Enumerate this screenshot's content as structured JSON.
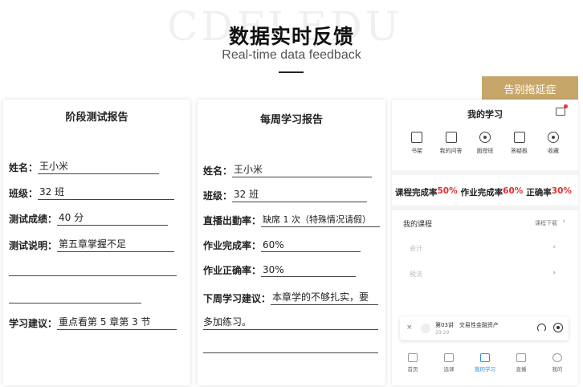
{
  "header": {
    "watermark": "CDFLEDU",
    "title": "数据实时反馈",
    "subtitle": "Real-time data feedback"
  },
  "tag_label": "告别拖延症",
  "stage_report": {
    "title": "阶段测试报告",
    "rows": [
      {
        "label": "姓名：",
        "value": "王小米"
      },
      {
        "label": "班级：",
        "value": "32 班"
      },
      {
        "label": "测试成绩：",
        "value": "40 分"
      },
      {
        "label": "测试说明：",
        "value": "第五章掌握不足"
      },
      {
        "label": "学习建议：",
        "value": "重点看第 5 章第 3 节"
      }
    ]
  },
  "weekly_report": {
    "title": "每周学习报告",
    "rows": [
      {
        "label": "姓名：",
        "value": "王小米"
      },
      {
        "label": "班级：",
        "value": "32 班"
      },
      {
        "label": "直播出勤率：",
        "value": "缺席 1 次（特殊情况请假）"
      },
      {
        "label": "作业完成率：",
        "value": "60%"
      },
      {
        "label": "作业正确率：",
        "value": "30%"
      },
      {
        "label": "下周学习建议：",
        "value": "本章学的不够扎实，要"
      }
    ],
    "continuation": "多加练习。"
  },
  "app": {
    "title": "我的学习",
    "nav": [
      {
        "label": "书架",
        "icon": "bookshelf-icon"
      },
      {
        "label": "我的问答",
        "icon": "chat-icon"
      },
      {
        "label": "面授班",
        "icon": "person-icon"
      },
      {
        "label": "答疑板",
        "icon": "clipboard-icon"
      },
      {
        "label": "收藏",
        "icon": "target-icon"
      }
    ],
    "stats": [
      {
        "label": "课程完成率",
        "value": "50%"
      },
      {
        "label": "作业完成率",
        "value": "60%"
      },
      {
        "label": "正确率",
        "value": "30%"
      }
    ],
    "courses_title": "我的课程",
    "courses_link": "课程下载",
    "chevron": "›",
    "courses": [
      "会计",
      "税法"
    ],
    "player": {
      "close": "×",
      "lesson": "第03讲　交易性金融资产",
      "time": "29:29"
    },
    "tabs": [
      {
        "label": "首页",
        "active": false
      },
      {
        "label": "选课",
        "active": false
      },
      {
        "label": "我的学习",
        "active": true
      },
      {
        "label": "直播",
        "active": false
      },
      {
        "label": "我的",
        "active": false
      }
    ]
  }
}
